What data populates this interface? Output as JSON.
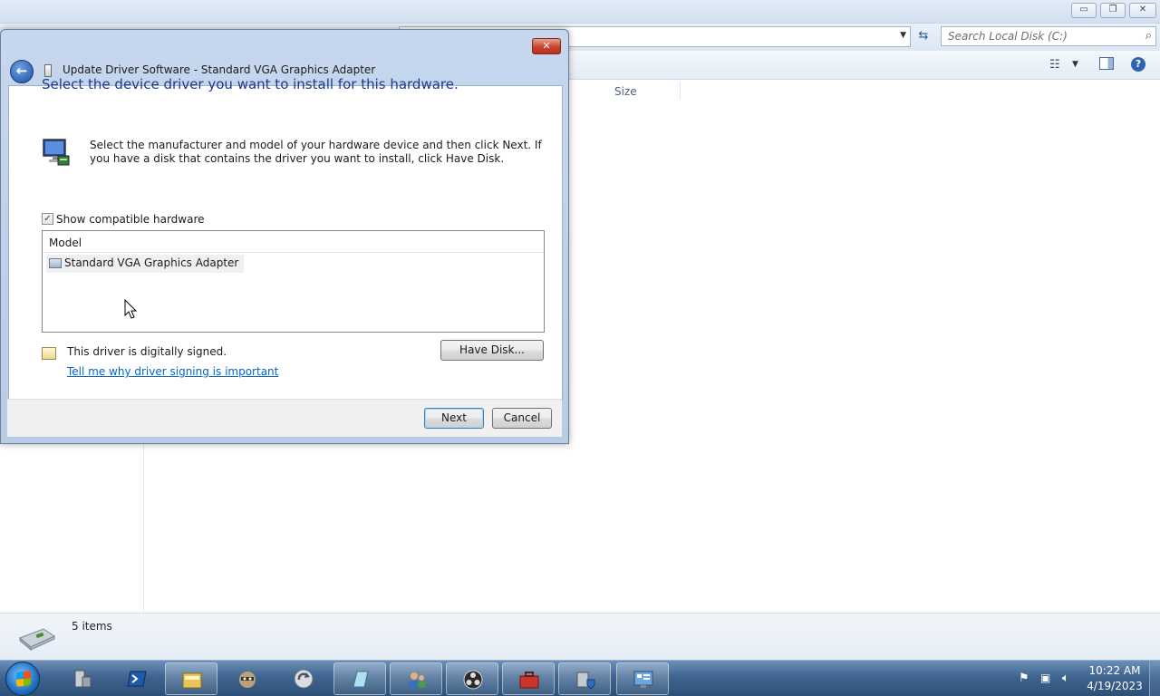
{
  "explorer": {
    "search_placeholder": "Search Local Disk (C:)",
    "column_size": "Size",
    "status_count": "5 items",
    "minimize_glyph": "▭",
    "maximize_glyph": "❐",
    "close_glyph": "✕"
  },
  "dialog": {
    "title": "Update Driver Software - Standard VGA Graphics Adapter",
    "heading": "Select the device driver you want to install for this hardware.",
    "instructions": "Select the manufacturer and model of your hardware device and then click Next. If you have a disk that contains the driver you want to install, click Have Disk.",
    "show_compatible": {
      "label": "Show compatible hardware",
      "checked": true
    },
    "model_list": {
      "header": "Model",
      "items": [
        "Standard VGA Graphics Adapter"
      ],
      "selected_index": 0
    },
    "signed_text": "This driver is digitally signed.",
    "signing_link": "Tell me why driver signing is important",
    "buttons": {
      "have_disk": "Have Disk...",
      "next": "Next",
      "cancel": "Cancel"
    },
    "close_glyph": "✕",
    "back_glyph": "←"
  },
  "taskbar": {
    "items": [
      {
        "name": "server-manager-icon",
        "active": false
      },
      {
        "name": "powershell-icon",
        "active": false
      },
      {
        "name": "windows-explorer-icon",
        "active": true
      },
      {
        "name": "raccoon-app-icon",
        "active": false
      },
      {
        "name": "refresh-app-icon",
        "active": false
      },
      {
        "name": "notepad-app-icon",
        "active": true
      },
      {
        "name": "users-app-icon",
        "active": true
      },
      {
        "name": "obs-icon",
        "active": true
      },
      {
        "name": "toolbox-icon",
        "active": true
      },
      {
        "name": "device-manager-icon",
        "active": true
      },
      {
        "name": "control-panel-icon",
        "active": true
      }
    ],
    "clock": {
      "time": "10:22 AM",
      "date": "4/19/2023"
    }
  },
  "colors": {
    "accent": "#1f3a8a",
    "link": "#0066cc",
    "taskbar": "#3f648f"
  }
}
